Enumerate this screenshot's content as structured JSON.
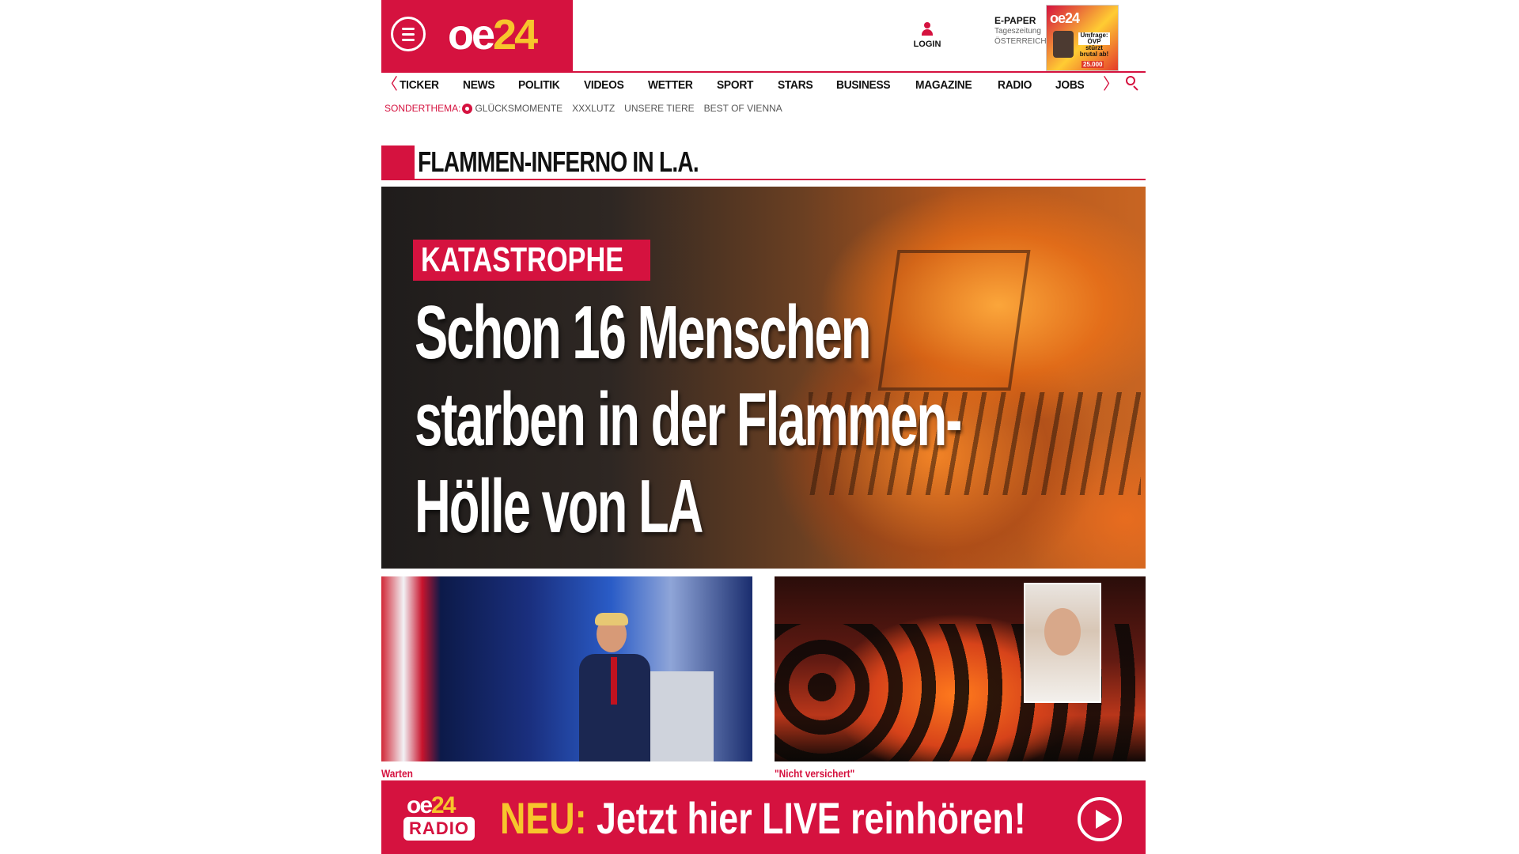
{
  "header": {
    "logo": {
      "part1": "oe",
      "part2": "24"
    },
    "login_label": "LOGIN",
    "epaper": {
      "title": "E-PAPER",
      "line2": "Tageszeitung",
      "line3": "ÖSTERREICH",
      "thumb_logo": "oe24",
      "thumb_headline": "Umfrage: ÖVP stürzt brutal ab!",
      "thumb_price": "25.000"
    }
  },
  "nav": {
    "items": [
      "TICKER",
      "NEWS",
      "POLITIK",
      "VIDEOS",
      "WETTER",
      "SPORT",
      "STARS",
      "BUSINESS",
      "MAGAZINE",
      "RADIO",
      "JOBS"
    ],
    "prev_arrow": "〈",
    "next_arrow": "〉"
  },
  "subnav": {
    "lead": "SONDERTHEMA:",
    "items": [
      "GLÜCKSMOMENTE",
      "XXXLUTZ",
      "UNSERE TIERE",
      "BEST OF VIENNA"
    ]
  },
  "section": {
    "title": "FLAMMEN-INFERNO IN L.A."
  },
  "hero": {
    "kicker": "KATASTROPHE",
    "headline": "Schon 16 Menschen starben in der Flammen-Hölle von LA"
  },
  "teasers": [
    {
      "label": "Warten"
    },
    {
      "label": "\"Nicht versichert\""
    }
  ],
  "radio_banner": {
    "logo_top": {
      "part1": "oe",
      "part2": "24"
    },
    "logo_badge": "RADIO",
    "neu": "NEU:",
    "text": "Jetzt hier LIVE reinhören!"
  },
  "colors": {
    "brand_red": "#d5123f",
    "accent_yellow": "#f7c52c"
  }
}
